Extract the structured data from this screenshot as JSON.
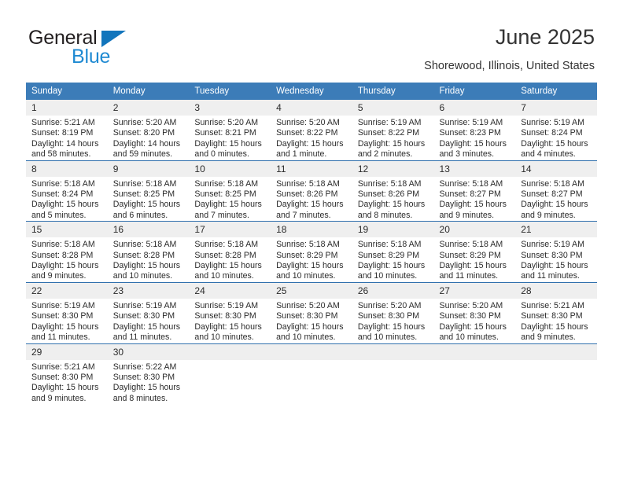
{
  "brand": {
    "name_part1": "General",
    "name_part2": "Blue",
    "triangle_color": "#1275bc",
    "blue_text_color": "#1f8ad2"
  },
  "header": {
    "title": "June 2025",
    "location": "Shorewood, Illinois, United States",
    "accent_color": "#3c7cb8",
    "daynum_band_color": "#efefef"
  },
  "weekday_headers": [
    "Sunday",
    "Monday",
    "Tuesday",
    "Wednesday",
    "Thursday",
    "Friday",
    "Saturday"
  ],
  "calendar": {
    "month": "June",
    "year": "2025",
    "weeks": [
      [
        {
          "day": "1",
          "sunrise": "Sunrise: 5:21 AM",
          "sunset": "Sunset: 8:19 PM",
          "daylight_line1": "Daylight: 14 hours",
          "daylight_line2": "and 58 minutes."
        },
        {
          "day": "2",
          "sunrise": "Sunrise: 5:20 AM",
          "sunset": "Sunset: 8:20 PM",
          "daylight_line1": "Daylight: 14 hours",
          "daylight_line2": "and 59 minutes."
        },
        {
          "day": "3",
          "sunrise": "Sunrise: 5:20 AM",
          "sunset": "Sunset: 8:21 PM",
          "daylight_line1": "Daylight: 15 hours",
          "daylight_line2": "and 0 minutes."
        },
        {
          "day": "4",
          "sunrise": "Sunrise: 5:20 AM",
          "sunset": "Sunset: 8:22 PM",
          "daylight_line1": "Daylight: 15 hours",
          "daylight_line2": "and 1 minute."
        },
        {
          "day": "5",
          "sunrise": "Sunrise: 5:19 AM",
          "sunset": "Sunset: 8:22 PM",
          "daylight_line1": "Daylight: 15 hours",
          "daylight_line2": "and 2 minutes."
        },
        {
          "day": "6",
          "sunrise": "Sunrise: 5:19 AM",
          "sunset": "Sunset: 8:23 PM",
          "daylight_line1": "Daylight: 15 hours",
          "daylight_line2": "and 3 minutes."
        },
        {
          "day": "7",
          "sunrise": "Sunrise: 5:19 AM",
          "sunset": "Sunset: 8:24 PM",
          "daylight_line1": "Daylight: 15 hours",
          "daylight_line2": "and 4 minutes."
        }
      ],
      [
        {
          "day": "8",
          "sunrise": "Sunrise: 5:18 AM",
          "sunset": "Sunset: 8:24 PM",
          "daylight_line1": "Daylight: 15 hours",
          "daylight_line2": "and 5 minutes."
        },
        {
          "day": "9",
          "sunrise": "Sunrise: 5:18 AM",
          "sunset": "Sunset: 8:25 PM",
          "daylight_line1": "Daylight: 15 hours",
          "daylight_line2": "and 6 minutes."
        },
        {
          "day": "10",
          "sunrise": "Sunrise: 5:18 AM",
          "sunset": "Sunset: 8:25 PM",
          "daylight_line1": "Daylight: 15 hours",
          "daylight_line2": "and 7 minutes."
        },
        {
          "day": "11",
          "sunrise": "Sunrise: 5:18 AM",
          "sunset": "Sunset: 8:26 PM",
          "daylight_line1": "Daylight: 15 hours",
          "daylight_line2": "and 7 minutes."
        },
        {
          "day": "12",
          "sunrise": "Sunrise: 5:18 AM",
          "sunset": "Sunset: 8:26 PM",
          "daylight_line1": "Daylight: 15 hours",
          "daylight_line2": "and 8 minutes."
        },
        {
          "day": "13",
          "sunrise": "Sunrise: 5:18 AM",
          "sunset": "Sunset: 8:27 PM",
          "daylight_line1": "Daylight: 15 hours",
          "daylight_line2": "and 9 minutes."
        },
        {
          "day": "14",
          "sunrise": "Sunrise: 5:18 AM",
          "sunset": "Sunset: 8:27 PM",
          "daylight_line1": "Daylight: 15 hours",
          "daylight_line2": "and 9 minutes."
        }
      ],
      [
        {
          "day": "15",
          "sunrise": "Sunrise: 5:18 AM",
          "sunset": "Sunset: 8:28 PM",
          "daylight_line1": "Daylight: 15 hours",
          "daylight_line2": "and 9 minutes."
        },
        {
          "day": "16",
          "sunrise": "Sunrise: 5:18 AM",
          "sunset": "Sunset: 8:28 PM",
          "daylight_line1": "Daylight: 15 hours",
          "daylight_line2": "and 10 minutes."
        },
        {
          "day": "17",
          "sunrise": "Sunrise: 5:18 AM",
          "sunset": "Sunset: 8:28 PM",
          "daylight_line1": "Daylight: 15 hours",
          "daylight_line2": "and 10 minutes."
        },
        {
          "day": "18",
          "sunrise": "Sunrise: 5:18 AM",
          "sunset": "Sunset: 8:29 PM",
          "daylight_line1": "Daylight: 15 hours",
          "daylight_line2": "and 10 minutes."
        },
        {
          "day": "19",
          "sunrise": "Sunrise: 5:18 AM",
          "sunset": "Sunset: 8:29 PM",
          "daylight_line1": "Daylight: 15 hours",
          "daylight_line2": "and 10 minutes."
        },
        {
          "day": "20",
          "sunrise": "Sunrise: 5:18 AM",
          "sunset": "Sunset: 8:29 PM",
          "daylight_line1": "Daylight: 15 hours",
          "daylight_line2": "and 11 minutes."
        },
        {
          "day": "21",
          "sunrise": "Sunrise: 5:19 AM",
          "sunset": "Sunset: 8:30 PM",
          "daylight_line1": "Daylight: 15 hours",
          "daylight_line2": "and 11 minutes."
        }
      ],
      [
        {
          "day": "22",
          "sunrise": "Sunrise: 5:19 AM",
          "sunset": "Sunset: 8:30 PM",
          "daylight_line1": "Daylight: 15 hours",
          "daylight_line2": "and 11 minutes."
        },
        {
          "day": "23",
          "sunrise": "Sunrise: 5:19 AM",
          "sunset": "Sunset: 8:30 PM",
          "daylight_line1": "Daylight: 15 hours",
          "daylight_line2": "and 11 minutes."
        },
        {
          "day": "24",
          "sunrise": "Sunrise: 5:19 AM",
          "sunset": "Sunset: 8:30 PM",
          "daylight_line1": "Daylight: 15 hours",
          "daylight_line2": "and 10 minutes."
        },
        {
          "day": "25",
          "sunrise": "Sunrise: 5:20 AM",
          "sunset": "Sunset: 8:30 PM",
          "daylight_line1": "Daylight: 15 hours",
          "daylight_line2": "and 10 minutes."
        },
        {
          "day": "26",
          "sunrise": "Sunrise: 5:20 AM",
          "sunset": "Sunset: 8:30 PM",
          "daylight_line1": "Daylight: 15 hours",
          "daylight_line2": "and 10 minutes."
        },
        {
          "day": "27",
          "sunrise": "Sunrise: 5:20 AM",
          "sunset": "Sunset: 8:30 PM",
          "daylight_line1": "Daylight: 15 hours",
          "daylight_line2": "and 10 minutes."
        },
        {
          "day": "28",
          "sunrise": "Sunrise: 5:21 AM",
          "sunset": "Sunset: 8:30 PM",
          "daylight_line1": "Daylight: 15 hours",
          "daylight_line2": "and 9 minutes."
        }
      ],
      [
        {
          "day": "29",
          "sunrise": "Sunrise: 5:21 AM",
          "sunset": "Sunset: 8:30 PM",
          "daylight_line1": "Daylight: 15 hours",
          "daylight_line2": "and 9 minutes."
        },
        {
          "day": "30",
          "sunrise": "Sunrise: 5:22 AM",
          "sunset": "Sunset: 8:30 PM",
          "daylight_line1": "Daylight: 15 hours",
          "daylight_line2": "and 8 minutes."
        },
        {
          "day": "",
          "sunrise": "",
          "sunset": "",
          "daylight_line1": "",
          "daylight_line2": ""
        },
        {
          "day": "",
          "sunrise": "",
          "sunset": "",
          "daylight_line1": "",
          "daylight_line2": ""
        },
        {
          "day": "",
          "sunrise": "",
          "sunset": "",
          "daylight_line1": "",
          "daylight_line2": ""
        },
        {
          "day": "",
          "sunrise": "",
          "sunset": "",
          "daylight_line1": "",
          "daylight_line2": ""
        },
        {
          "day": "",
          "sunrise": "",
          "sunset": "",
          "daylight_line1": "",
          "daylight_line2": ""
        }
      ]
    ]
  }
}
